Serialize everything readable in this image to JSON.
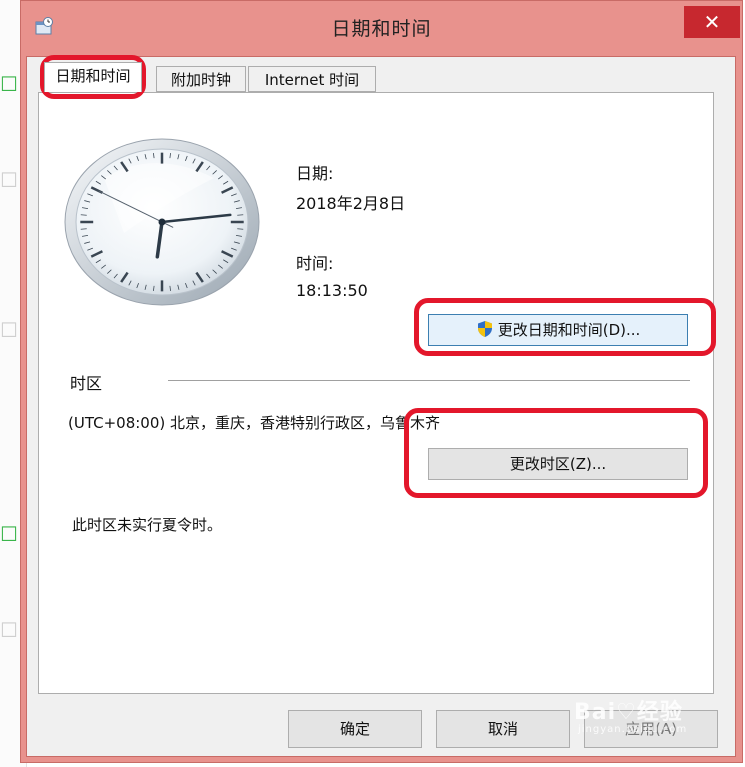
{
  "window": {
    "title": "日期和时间",
    "close_glyph": "✕"
  },
  "tabs": [
    {
      "label": "日期和时间"
    },
    {
      "label": "附加时钟"
    },
    {
      "label": "Internet 时间"
    }
  ],
  "datetime": {
    "date_label": "日期:",
    "date_value": "2018年2月8日",
    "time_label": "时间:",
    "time_value": "18:13:50",
    "change_button": "更改日期和时间(D)..."
  },
  "timezone": {
    "section_label": "时区",
    "value": "(UTC+08:00) 北京，重庆，香港特别行政区，乌鲁木齐",
    "change_button": "更改时区(Z)...",
    "dst_note": "此时区未实行夏令时。"
  },
  "footer": {
    "ok": "确定",
    "cancel": "取消",
    "apply": "应用(A)"
  },
  "watermark": {
    "text": "Bai♡经验",
    "sub": "jingyan.baidu.com"
  },
  "clock": {
    "hour": 18,
    "minute": 13,
    "second": 50
  },
  "colors": {
    "frame": "#e8928d",
    "close": "#c7282f",
    "highlight": "#e3172b"
  },
  "icons": [
    "datetime-app-icon",
    "uac-shield-icon",
    "close-icon"
  ]
}
